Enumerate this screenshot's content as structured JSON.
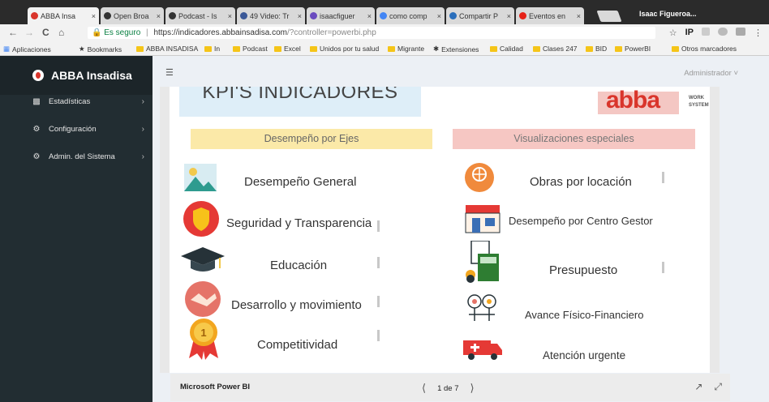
{
  "browser": {
    "tabs": [
      {
        "title": "ABBA Insa",
        "favicon_color": "#d9352b",
        "active": true
      },
      {
        "title": "Open Broa",
        "favicon_color": "#333333"
      },
      {
        "title": "Podcast - Is",
        "favicon_color": "#333333"
      },
      {
        "title": "49 Video: Tr",
        "favicon_color": "#3b5998"
      },
      {
        "title": "isaacfiguer",
        "favicon_color": "#6a4bbf"
      },
      {
        "title": "como comp",
        "favicon_color": "#4285f4"
      },
      {
        "title": "Compartir P",
        "favicon_color": "#2a6ebb"
      },
      {
        "title": "Eventos en",
        "favicon_color": "#e62117"
      }
    ],
    "tab_close": "×",
    "profile_name": "Isaac Figueroa...",
    "nav": {
      "back": "←",
      "forward": "→",
      "reload": "C",
      "home": "⌂"
    },
    "secure_label": "Es seguro",
    "url_host": "https://indicadores.abbainsadisa.com",
    "url_path": "/?controller=powerbi.php",
    "toolbar_icons": [
      "☆",
      "IP",
      "⋮"
    ],
    "bookmarks": [
      "Aplicaciones",
      "Bookmarks",
      "ABBA INSADISA",
      "In",
      "Podcast",
      "Excel",
      "Unidos por tu salud",
      "Migrante",
      "Extensiones",
      "Calidad",
      "Clases 247",
      "BID",
      "PowerBI",
      "Otros marcadores"
    ]
  },
  "app": {
    "brand": "ABBA Insadisa",
    "user": "Administrador",
    "sidebar": [
      {
        "label": "Estadísticas",
        "icon": "bar-chart-icon"
      },
      {
        "label": "Configuración",
        "icon": "gear-icon"
      },
      {
        "label": "Admin. del Sistema",
        "icon": "gears-icon"
      }
    ]
  },
  "report": {
    "title": "KPI'S INDICADORES",
    "logo_text": "abba",
    "logo_side": [
      "WORK",
      "SYSTEM"
    ],
    "left_header": "Desempeño por Ejes",
    "right_header": "Visualizaciones especiales",
    "left_items": [
      "Desempeño General",
      "Seguridad y Transparencia",
      "Educación",
      "Desarrollo y movimiento",
      "Competitividad"
    ],
    "right_items": [
      "Obras por locación",
      "Desempeño por Centro Gestor",
      "Presupuesto",
      "Avance Físico-Financiero",
      "Atención urgente"
    ],
    "footer_brand": "Microsoft Power BI",
    "page_indicator": "1 de 7"
  }
}
